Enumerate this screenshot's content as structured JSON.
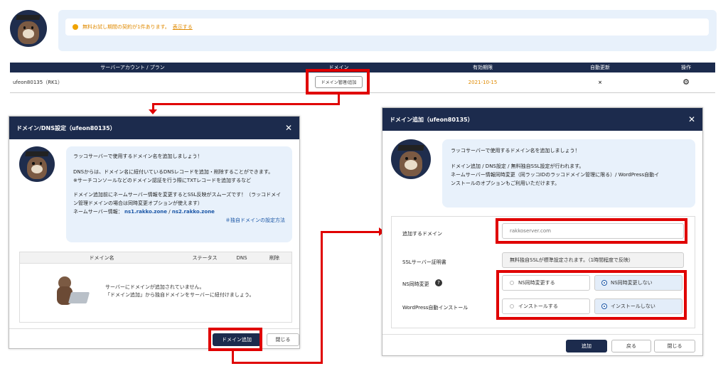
{
  "notice": {
    "text": "無料お試し期間の契約が1件あります。",
    "link": "表示する"
  },
  "account_table": {
    "headers": [
      "サーバーアカウント / プラン",
      "ドメイン",
      "有効期限",
      "自動更新",
      "操作"
    ],
    "row": {
      "account": "ufeon80135（RK1）",
      "domain_button": "ドメイン管理/追加",
      "expiry": "2021-10-15",
      "auto_renew": "×"
    }
  },
  "dns_modal": {
    "title": "ドメイン/DNS設定（ufeon80135）",
    "bubble": [
      "ラッコサーバーで使用するドメイン名を追加しましょう！",
      "DNSからは、ドメイン名に紐付いているDNSレコードを追加・削除することができます。",
      "※サーチコンソールなどのドメイン認証を行う際にTXTレコードを追加するなど",
      "ドメイン追加前にネームサーバー情報を変更するとSSL反映がスムーズです！（ラッコドメイ",
      "ン管理ドメインの場合は同時変更オプションが使えます）"
    ],
    "ns_label": "ネームサーバー情報：",
    "ns1": "ns1.rakko.zone",
    "ns_sep": "/",
    "ns2": "ns2.rakko.zone",
    "own_domain_link": "＃独自ドメインの設定方法",
    "table_headers": [
      "ドメイン名",
      "ステータス",
      "DNS",
      "削除"
    ],
    "empty_line1": "サーバーにドメインが追加されていません。",
    "empty_line2": "「ドメイン追加」から独自ドメインをサーバーに紐付けましょう。",
    "add_button": "ドメイン追加",
    "close_button": "閉じる"
  },
  "add_modal": {
    "title": "ドメイン追加（ufeon80135）",
    "bubble": [
      "ラッコサーバーで使用するドメイン名を追加しましょう！",
      "ドメイン追加 / DNS設定 / 無料独自SSL設定が行われます。",
      "ネームサーバー情報同時変更（同ラッコIDのラッコドメイン管理に限る）/ WordPress自動イ",
      "ンストールのオプションもご利用いただけます。"
    ],
    "domain_label": "追加するドメイン",
    "domain_placeholder": "rakkoserver.com",
    "ssl_label": "SSLサーバー証明書",
    "ssl_value": "無料独自SSLが標準設定されます。（1時間程度で反映）",
    "ns_label": "NS同時変更",
    "ns_opt1": "NS同時変更する",
    "ns_opt2": "NS同時変更しない",
    "wp_label": "WordPress自動インストール",
    "wp_opt1": "インストールする",
    "wp_opt2": "インストールしない",
    "btn_add": "追加",
    "btn_back": "戻る",
    "btn_close": "閉じる"
  },
  "colors": {
    "navy": "#1c2b4d",
    "red": "#e00000",
    "orange": "#e08a00",
    "link": "#1a56a6"
  }
}
